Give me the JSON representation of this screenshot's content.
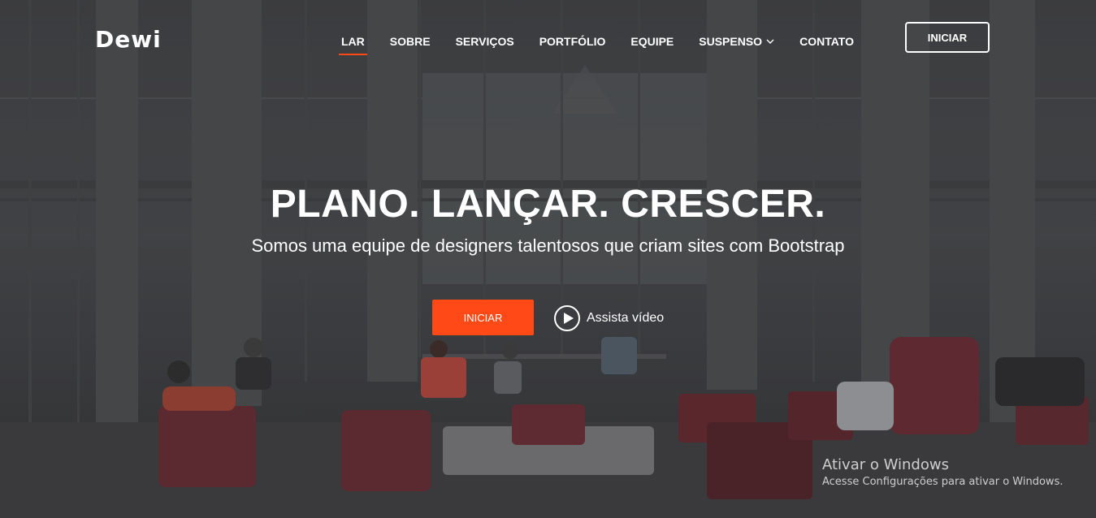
{
  "brand": {
    "name": "Dewi"
  },
  "nav": {
    "items": [
      {
        "label": "LAR"
      },
      {
        "label": "SOBRE"
      },
      {
        "label": "SERVIÇOS"
      },
      {
        "label": "PORTFÓLIO"
      },
      {
        "label": "EQUIPE"
      },
      {
        "label": "SUSPENSO"
      },
      {
        "label": "CONTATO"
      }
    ],
    "cta_label": "INICIAR"
  },
  "hero": {
    "title": "PLANO. LANÇAR. CRESCER.",
    "subtitle": "Somos uma equipe de designers talentosos que criam sites com Bootstrap",
    "primary_button": "INICIAR",
    "watch_label": "Assista vídeo"
  },
  "windows_watermark": {
    "title": "Ativar o Windows",
    "subtitle": "Acesse Configurações para ativar o Windows."
  },
  "colors": {
    "accent": "#ff4a17",
    "text": "#ffffff"
  },
  "icons": {
    "dropdown": "chevron-down-icon",
    "play": "play-icon"
  }
}
